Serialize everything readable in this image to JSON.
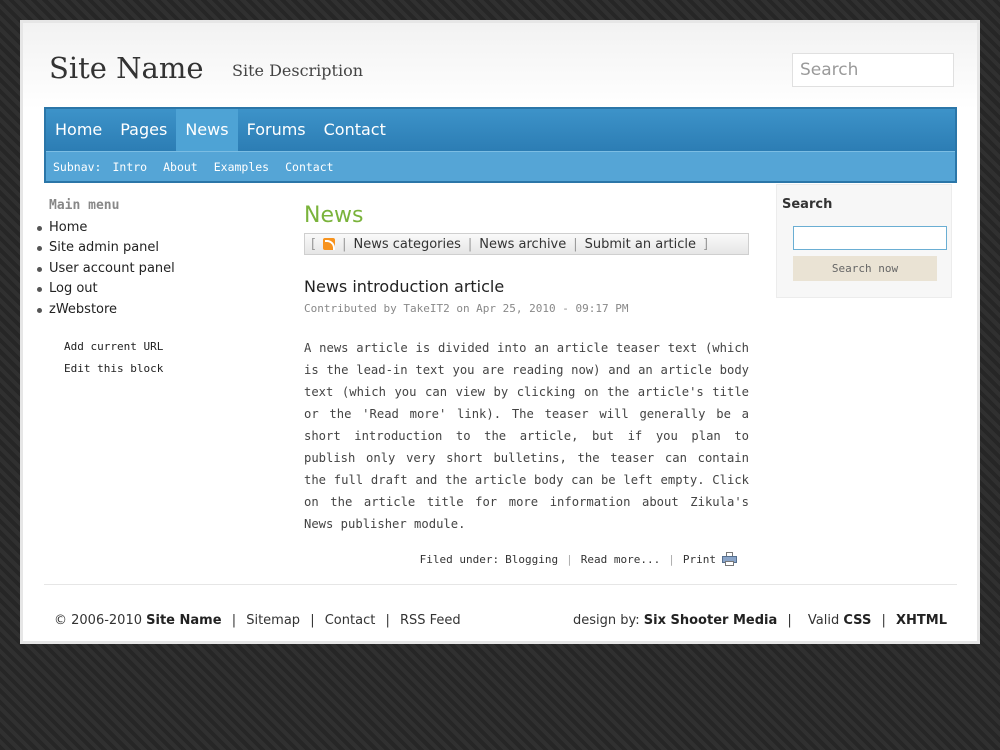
{
  "header": {
    "site_name": "Site Name",
    "site_description": "Site Description",
    "search_placeholder": "Search"
  },
  "mainnav": [
    {
      "label": "Home",
      "active": false
    },
    {
      "label": "Pages",
      "active": false
    },
    {
      "label": "News",
      "active": true
    },
    {
      "label": "Forums",
      "active": false
    },
    {
      "label": "Contact",
      "active": false
    }
  ],
  "subnav": {
    "label": "Subnav:",
    "links": [
      "Intro",
      "About",
      "Examples",
      "Contact"
    ]
  },
  "left": {
    "menu_title": "Main menu",
    "menu_items": [
      "Home",
      "Site admin panel",
      "User account panel",
      "Log out",
      "zWebstore"
    ],
    "block_links": [
      "Add current URL",
      "Edit this block"
    ]
  },
  "content": {
    "title": "News",
    "bar": {
      "open": "[",
      "close": "]",
      "sep": "|",
      "links": [
        "News categories",
        "News archive",
        "Submit an article"
      ]
    },
    "article": {
      "title": "News introduction article",
      "meta": "Contributed by TakeIT2 on Apr 25, 2010 - 09:17 PM",
      "body": "A news article is divided into an article teaser text (which is the lead-in text you are reading now) and an article body text (which you can view by clicking on the article's title or the 'Read more' link). The teaser will generally be a short introduction to the article, but if you plan to publish only very short bulletins, the teaser can contain the full draft and the article body can be left empty. Click on the article title for more information about Zikula's News publisher module.",
      "filed_label": "Filed under:",
      "category": "Blogging",
      "read_more": "Read more...",
      "print": "Print"
    }
  },
  "right": {
    "title": "Search",
    "input_value": "",
    "button": "Search now"
  },
  "footer": {
    "copyright": "© 2006-2010",
    "site_name": "Site Name",
    "links": [
      "Sitemap",
      "Contact",
      "RSS Feed"
    ],
    "design_by": "design by:",
    "designer": "Six Shooter Media",
    "valid": "Valid",
    "css": "CSS",
    "xhtml": "XHTML",
    "sep": "|"
  },
  "colors": {
    "nav_blue": "#2c7db4",
    "subnav_blue": "#55a5d6",
    "news_green": "#7ab33b",
    "rss_orange": "#f7931e"
  }
}
